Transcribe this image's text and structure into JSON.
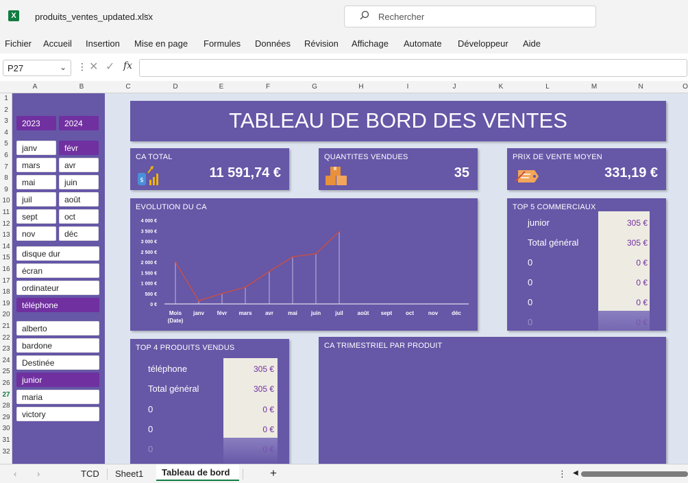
{
  "titlebar": {
    "filename": "produits_ventes_updated.xlsx",
    "search_placeholder": "Rechercher"
  },
  "menu": [
    "Fichier",
    "Accueil",
    "Insertion",
    "Mise en page",
    "Formules",
    "Données",
    "Révision",
    "Affichage",
    "Automate",
    "Développeur",
    "Aide"
  ],
  "formula_bar": {
    "cell_ref": "P27",
    "fx": "fx",
    "formula": ""
  },
  "columns": [
    "A",
    "B",
    "C",
    "D",
    "E",
    "F",
    "G",
    "H",
    "I",
    "J",
    "K",
    "L",
    "M",
    "N",
    "O"
  ],
  "rows": [
    "1",
    "2",
    "3",
    "4",
    "5",
    "6",
    "7",
    "8",
    "9",
    "10",
    "11",
    "12",
    "13",
    "14",
    "15",
    "16",
    "17",
    "18",
    "19",
    "20",
    "21",
    "22",
    "23",
    "24",
    "25",
    "26",
    "27",
    "28",
    "29",
    "30",
    "31",
    "32"
  ],
  "slicers": {
    "years": [
      {
        "label": "2023",
        "selected": true
      },
      {
        "label": "2024",
        "selected": true
      }
    ],
    "months": [
      {
        "label": "janv",
        "selected": false
      },
      {
        "label": "févr",
        "selected": true
      },
      {
        "label": "mars",
        "selected": false
      },
      {
        "label": "avr",
        "selected": false
      },
      {
        "label": "mai",
        "selected": false
      },
      {
        "label": "juin",
        "selected": false
      },
      {
        "label": "juil",
        "selected": false
      },
      {
        "label": "août",
        "selected": false
      },
      {
        "label": "sept",
        "selected": false
      },
      {
        "label": "oct",
        "selected": false
      },
      {
        "label": "nov",
        "selected": false
      },
      {
        "label": "déc",
        "selected": false
      }
    ],
    "products": [
      {
        "label": "disque dur",
        "selected": false
      },
      {
        "label": "écran",
        "selected": false
      },
      {
        "label": "ordinateur",
        "selected": false
      },
      {
        "label": "téléphone",
        "selected": true
      }
    ],
    "sellers": [
      {
        "label": "alberto",
        "selected": false
      },
      {
        "label": "bardone",
        "selected": false
      },
      {
        "label": "Destinée",
        "selected": false
      },
      {
        "label": "junior",
        "selected": true
      },
      {
        "label": "maria",
        "selected": false
      },
      {
        "label": "victory",
        "selected": false
      }
    ]
  },
  "dashboard": {
    "title": "TABLEAU DE BORD DES VENTES",
    "kpis": [
      {
        "label": "CA TOTAL",
        "value": "11 591,74 €",
        "icon": "money-chart-icon"
      },
      {
        "label": "QUANTITES VENDUES",
        "value": "35",
        "icon": "boxes-icon"
      },
      {
        "label": "PRIX DE VENTE MOYEN",
        "value": "331,19 €",
        "icon": "price-tag-icon"
      }
    ],
    "evolution_title": "EVOLUTION DU CA",
    "top5_title": "TOP 5 COMMERCIAUX",
    "top5_rows": [
      {
        "label": "junior",
        "value": "305 €"
      },
      {
        "label": "Total général",
        "value": "305 €"
      },
      {
        "label": "0",
        "value": "0 €"
      },
      {
        "label": "0",
        "value": "0 €"
      },
      {
        "label": "0",
        "value": "0 €"
      },
      {
        "label": "0",
        "value": "0 €"
      }
    ],
    "top4_title": "TOP 4 PRODUITS VENDUS",
    "top4_rows": [
      {
        "label": "téléphone",
        "value": "305 €"
      },
      {
        "label": "Total général",
        "value": "305 €"
      },
      {
        "label": "0",
        "value": "0 €"
      },
      {
        "label": "0",
        "value": "0 €"
      },
      {
        "label": "0",
        "value": "0 €"
      }
    ],
    "trimestre_title": "CA TRIMESTRIEL PAR PRODUIT"
  },
  "chart_data": {
    "type": "line",
    "categories": [
      "Mois (Date)",
      "janv",
      "févr",
      "mars",
      "avr",
      "mai",
      "juin",
      "juil",
      "août",
      "sept",
      "oct",
      "nov",
      "déc"
    ],
    "series": [
      {
        "values": [
          2000,
          150,
          500,
          800,
          1550,
          2250,
          2400,
          3450,
          null,
          null,
          null,
          null,
          null
        ]
      }
    ],
    "yticks": [
      "0 €",
      "500 €",
      "1 000 €",
      "1 500 €",
      "2 000 €",
      "2 500 €",
      "3 000 €",
      "3 500 €",
      "4 000 €"
    ],
    "ylim": [
      0,
      4000
    ],
    "line_color": "#c0504d"
  },
  "sheet_tabs": [
    "TCD",
    "Sheet1",
    "Tableau de bord"
  ],
  "active_tab": "Tableau de bord"
}
